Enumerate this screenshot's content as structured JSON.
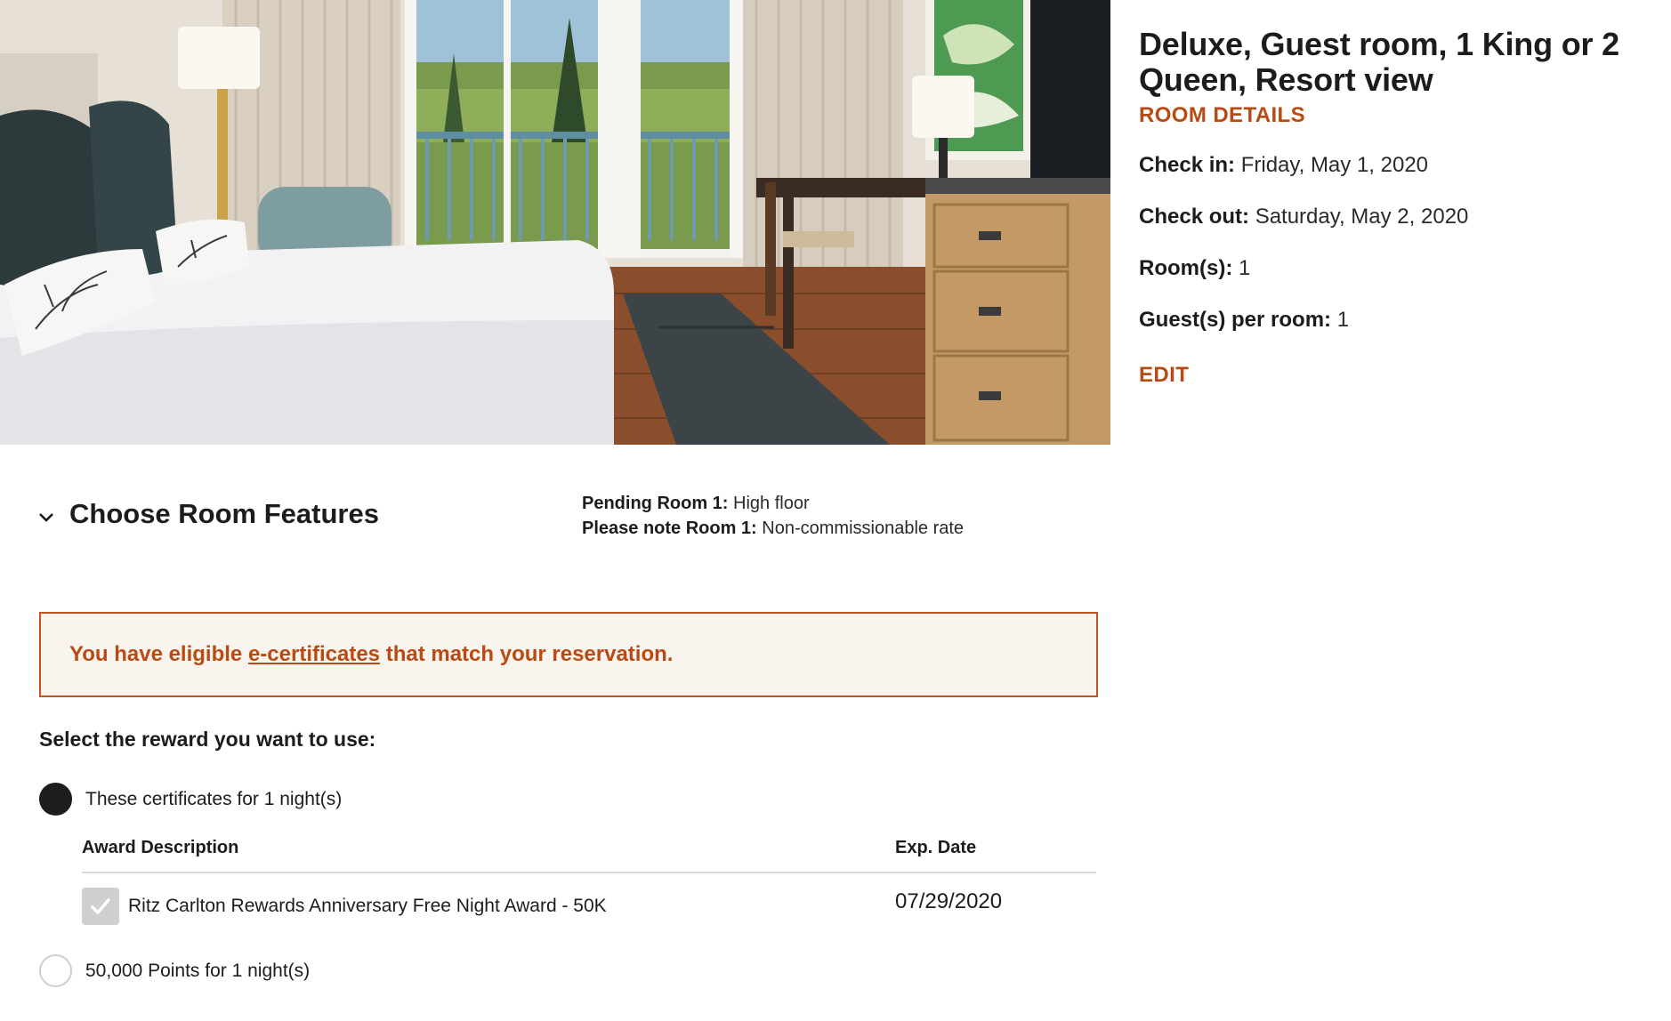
{
  "room": {
    "title": "Deluxe, Guest room, 1 King or 2 Queen, Resort view",
    "details_link": "ROOM DETAILS",
    "check_in_label": "Check in:",
    "check_in_value": "Friday, May 1, 2020",
    "check_out_label": "Check out:",
    "check_out_value": "Saturday, May 2, 2020",
    "rooms_label": "Room(s):",
    "rooms_value": "1",
    "guests_label": "Guest(s) per room:",
    "guests_value": "1",
    "edit_link": "EDIT"
  },
  "features": {
    "title": "Choose Room Features",
    "pending_label": "Pending Room 1:",
    "pending_value": "High floor",
    "note_label": "Please note Room 1:",
    "note_value": "Non-commissionable rate"
  },
  "alert": {
    "prefix": "You have eligible ",
    "link": "e-certificates",
    "suffix": " that match your reservation."
  },
  "rewards": {
    "heading": "Select the reward you want to use:",
    "option_certificates": "These certificates for 1 night(s)",
    "option_points": "50,000 Points for 1 night(s)",
    "selected": "certificates",
    "table": {
      "col_description": "Award Description",
      "col_exp": "Exp. Date",
      "rows": [
        {
          "description": "Ritz Carlton Rewards Anniversary Free Night Award - 50K",
          "exp_date": "07/29/2020",
          "checked": true
        }
      ]
    }
  },
  "colors": {
    "accent": "#b84a14",
    "alert_border": "#c2551d",
    "alert_bg": "#f9f4ee"
  }
}
